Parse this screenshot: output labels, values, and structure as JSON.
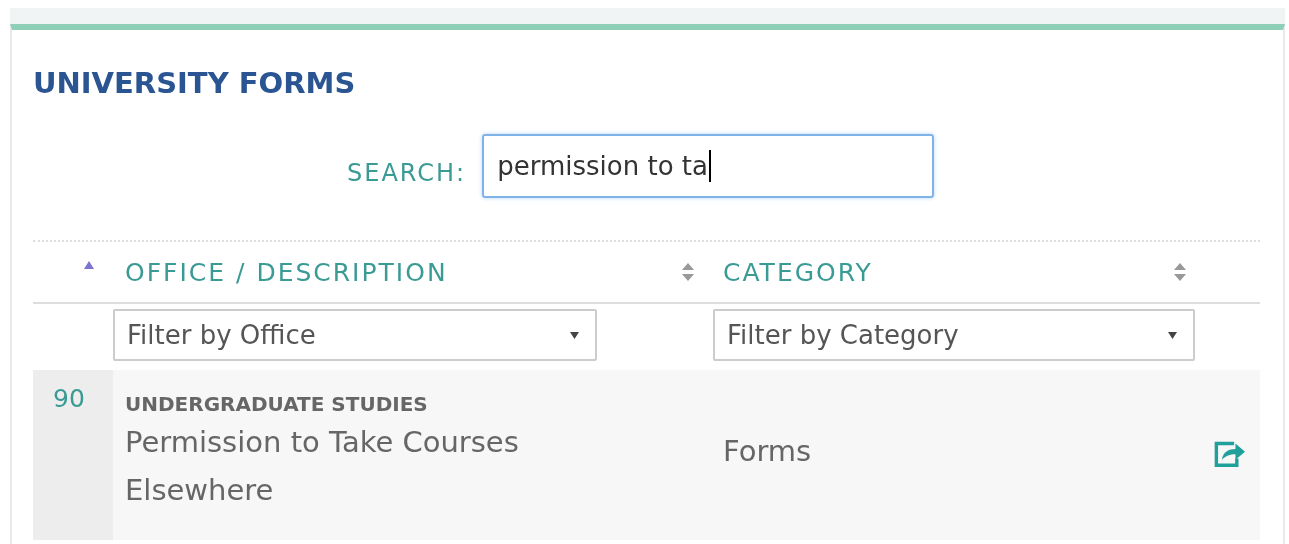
{
  "panel": {
    "title": "UNIVERSITY FORMS"
  },
  "search": {
    "label": "SEARCH:",
    "value": "permission to ta",
    "focused": true
  },
  "table": {
    "columns": [
      {
        "sorted": true
      },
      {
        "label": "OFFICE / DESCRIPTION",
        "sorted": false
      },
      {
        "label": "CATEGORY",
        "sorted": false
      }
    ],
    "filters": [
      {
        "placeholder": "Filter by Office"
      },
      {
        "placeholder": "Filter by Category"
      }
    ],
    "rows": [
      {
        "number": "90",
        "office": "UNDERGRADUATE STUDIES",
        "description": "Permission to Take Courses Elsewhere",
        "category": "Forms"
      }
    ]
  }
}
